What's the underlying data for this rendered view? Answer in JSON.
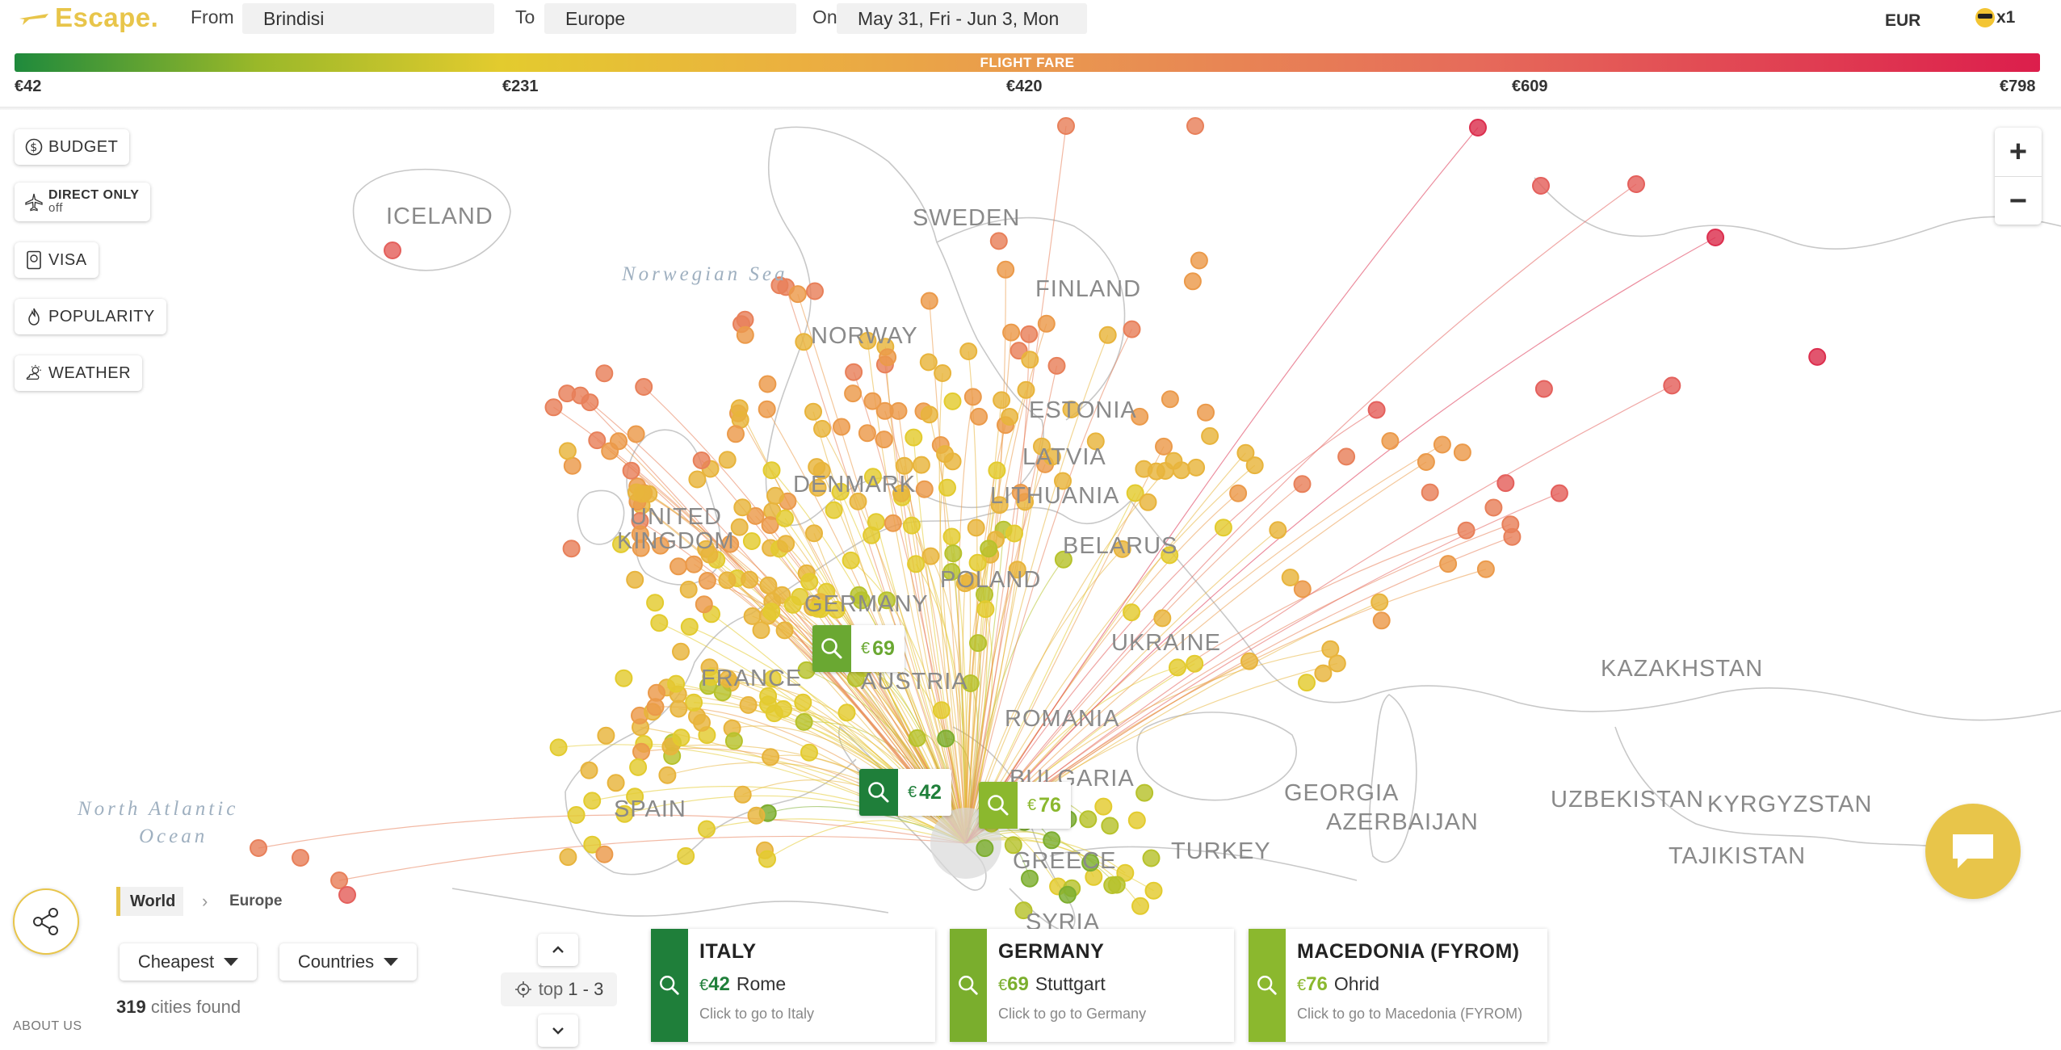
{
  "header": {
    "logo_text": "Escape.",
    "from_label": "From",
    "from_value": "Brindisi",
    "to_label": "To",
    "to_value": "Europe",
    "on_label": "On",
    "date_value": "May 31, Fri - Jun 3, Mon",
    "currency": "EUR",
    "passengers": "x1"
  },
  "fare_bar": {
    "title": "FLIGHT FARE",
    "ticks": [
      "€42",
      "€231",
      "€420",
      "€609",
      "€798"
    ]
  },
  "filters": [
    {
      "label": "BUDGET",
      "icon": "dollar-icon"
    },
    {
      "label": "DIRECT ONLY",
      "sub": "off",
      "icon": "plane-icon"
    },
    {
      "label": "VISA",
      "icon": "passport-icon"
    },
    {
      "label": "POPULARITY",
      "icon": "flame-icon"
    },
    {
      "label": "WEATHER",
      "icon": "sun-cloud-icon"
    }
  ],
  "zoom": {
    "in": "+",
    "out": "−"
  },
  "map_labels": {
    "countries": [
      "ICELAND",
      "SWEDEN",
      "FINLAND",
      "NORWAY",
      "ESTONIA",
      "LATVIA",
      "LITHUANIA",
      "DENMARK",
      "UNITED",
      "KINGDOM",
      "BELARUS",
      "POLAND",
      "GERMANY",
      "UKRAINE",
      "FRANCE",
      "AUSTRIA",
      "ROMANIA",
      "BULGARIA",
      "SPAIN",
      "GEORGIA",
      "AZERBAIJAN",
      "TURKEY",
      "GREECE",
      "SYRIA",
      "KAZAKHSTAN",
      "UZBEKISTAN",
      "KYRGYZSTAN",
      "TAJIKISTAN"
    ],
    "seas": [
      "Norwegian Sea",
      "North Atlantic",
      "Ocean"
    ]
  },
  "markers": [
    {
      "price": "69",
      "currency": "€",
      "color": "#6aa832"
    },
    {
      "price": "42",
      "currency": "€",
      "color": "#1f7f3a"
    },
    {
      "price": "76",
      "currency": "€",
      "color": "#8bb82e"
    }
  ],
  "breadcrumb": {
    "world": "World",
    "europe": "Europe"
  },
  "sort": {
    "value": "Cheapest"
  },
  "group": {
    "value": "Countries"
  },
  "results": {
    "count": "319",
    "suffix": "cities found"
  },
  "about": "ABOUT US",
  "pager": {
    "prefix": "top",
    "range": "1 - 3"
  },
  "cards": [
    {
      "country": "ITALY",
      "currency": "€",
      "price": "42",
      "city": "Rome",
      "hint": "Click to go to Italy",
      "color": "#1f7f3a"
    },
    {
      "country": "GERMANY",
      "currency": "€",
      "price": "69",
      "city": "Stuttgart",
      "hint": "Click to go to Germany",
      "color": "#7aae2d"
    },
    {
      "country": "MACEDONIA (FYROM)",
      "currency": "€",
      "price": "76",
      "city": "Ohrid",
      "hint": "Click to go to Macedonia (FYROM)",
      "color": "#8bb82e"
    }
  ]
}
